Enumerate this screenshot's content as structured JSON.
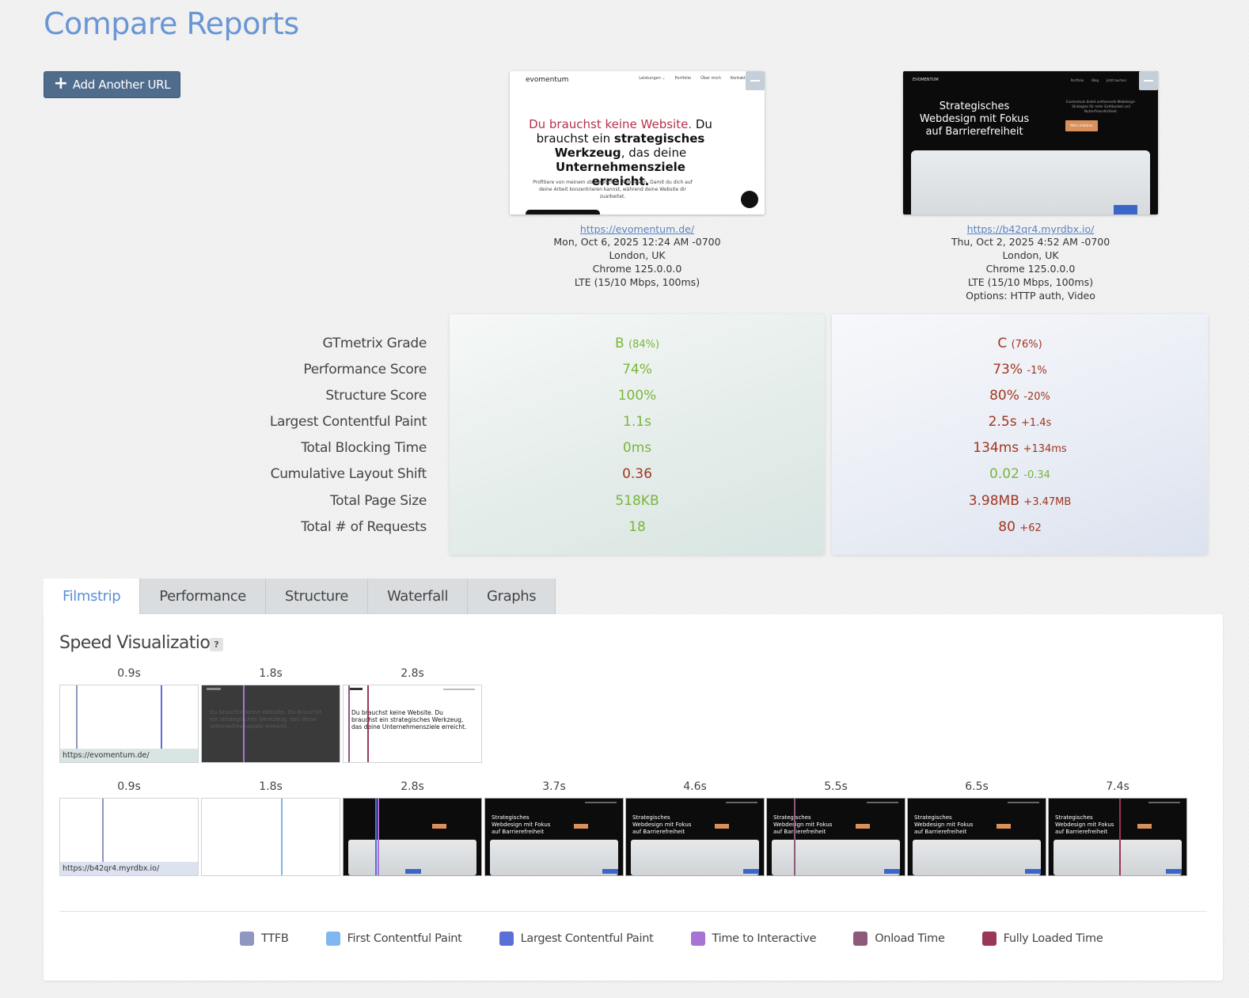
{
  "page": {
    "title": "Compare Reports"
  },
  "toolbar": {
    "add_url_label": "Add Another URL"
  },
  "reports": [
    {
      "url": "https://evomentum.de/",
      "date": "Mon, Oct 6, 2025 12:24 AM -0700",
      "location": "London, UK",
      "browser": "Chrome 125.0.0.0",
      "connection": "LTE (15/10 Mbps, 100ms)",
      "options": "",
      "thumb": {
        "logo": "evomentum",
        "nav": [
          "Leistungen ⌄",
          "Portfolio",
          "Über mich",
          "Kontakt"
        ],
        "headline_red": "Du brauchst keine Website.",
        "headline_1": " Du brauchst ein ",
        "headline_bold_1": "strategisches Werkzeug",
        "headline_2": ", das deine ",
        "headline_bold_2": "Unternehmensziele erreicht.",
        "sub": "Profitiere von meinem strategischen Webdesign. Damit du dich auf deine Arbeit konzentrieren kannst, während deine Website dir zuarbeitet."
      }
    },
    {
      "url": "https://b42qr4.myrdbx.io/",
      "date": "Thu, Oct 2, 2025 4:52 AM -0700",
      "location": "London, UK",
      "browser": "Chrome 125.0.0.0",
      "connection": "LTE (15/10 Mbps, 100ms)",
      "options": "Options: HTTP auth, Video",
      "thumb": {
        "logo": "EVOMENTUM",
        "nav": [
          "Portfolio",
          "Blog",
          "Jetzt buchen"
        ],
        "headline": "Strategisches Webdesign mit Fokus auf Barrierefreiheit",
        "side": "Evomentum bietet umfassende Webdesign-Strategien für mehr Sichtbarkeit und Nutzerfreundlichkeit.",
        "cta": "Mehr erfahren"
      }
    }
  ],
  "metrics": {
    "labels": [
      "GTmetrix Grade",
      "Performance Score",
      "Structure Score",
      "Largest Contentful Paint",
      "Total Blocking Time",
      "Cumulative Layout Shift",
      "Total Page Size",
      "Total # of Requests"
    ],
    "report1": [
      {
        "value": "B",
        "extra": "(84%)",
        "status": "good"
      },
      {
        "value": "74%",
        "extra": "",
        "status": "good"
      },
      {
        "value": "100%",
        "extra": "",
        "status": "good"
      },
      {
        "value": "1.1s",
        "extra": "",
        "status": "good"
      },
      {
        "value": "0ms",
        "extra": "",
        "status": "good"
      },
      {
        "value": "0.36",
        "extra": "",
        "status": "bad"
      },
      {
        "value": "518KB",
        "extra": "",
        "status": "good"
      },
      {
        "value": "18",
        "extra": "",
        "status": "good"
      }
    ],
    "report2": [
      {
        "value": "C",
        "extra": "(76%)",
        "status": "bad"
      },
      {
        "value": "73%",
        "extra": "-1%",
        "status": "bad"
      },
      {
        "value": "80%",
        "extra": "-20%",
        "status": "bad"
      },
      {
        "value": "2.5s",
        "extra": "+1.4s",
        "status": "bad"
      },
      {
        "value": "134ms",
        "extra": "+134ms",
        "status": "bad"
      },
      {
        "value": "0.02",
        "extra": "-0.34",
        "status": "good"
      },
      {
        "value": "3.98MB",
        "extra": "+3.47MB",
        "status": "bad"
      },
      {
        "value": "80",
        "extra": "+62",
        "status": "bad"
      }
    ]
  },
  "tabs": [
    "Filmstrip",
    "Performance",
    "Structure",
    "Waterfall",
    "Graphs"
  ],
  "active_tab": "Filmstrip",
  "speed_visualization": {
    "title": "Speed Visualization",
    "help": "?",
    "row1": {
      "url": "https://evomentum.de/",
      "frames": [
        "0.9s",
        "1.8s",
        "2.8s"
      ]
    },
    "row2": {
      "url": "https://b42qr4.myrdbx.io/",
      "frames": [
        "0.9s",
        "1.8s",
        "2.8s",
        "3.7s",
        "4.6s",
        "5.5s",
        "6.5s",
        "7.4s"
      ]
    },
    "frame_thumb_text": {
      "row1_headline": "Du brauchst keine Website. Du brauchst ein strategisches Werkzeug, das deine Unternehmensziele erreicht.",
      "row2_headline": "Strategisches Webdesign mit Fokus auf Barrierefreiheit"
    }
  },
  "legend": [
    {
      "label": "TTFB",
      "color": "#8f96bf"
    },
    {
      "label": "First Contentful Paint",
      "color": "#7fb7f0"
    },
    {
      "label": "Largest Contentful Paint",
      "color": "#5b6fd6"
    },
    {
      "label": "Time to Interactive",
      "color": "#a774d6"
    },
    {
      "label": "Onload Time",
      "color": "#8d5a7b"
    },
    {
      "label": "Fully Loaded Time",
      "color": "#9b3756"
    }
  ]
}
